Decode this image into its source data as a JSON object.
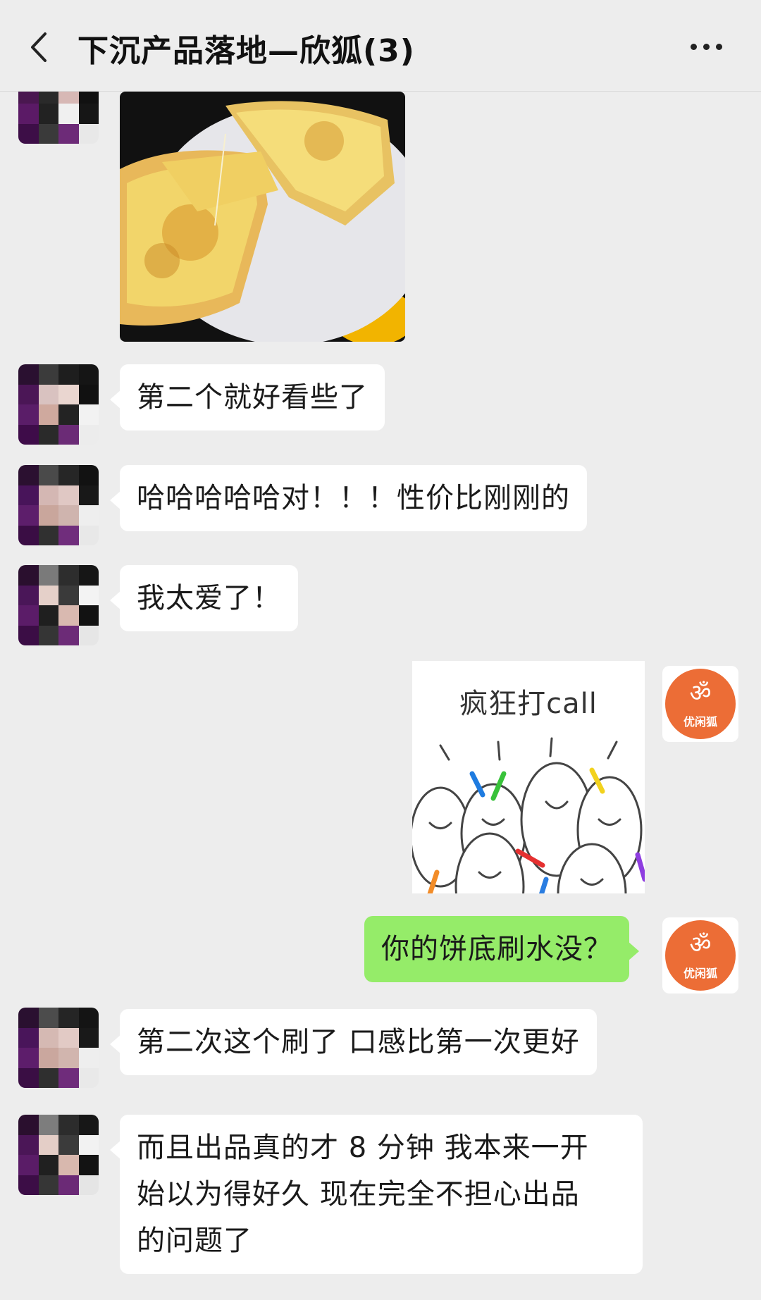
{
  "header": {
    "title": "下沉产品落地—欣狐(3)",
    "back_icon": "chevron-left-icon",
    "more_icon": "more-dots-icon"
  },
  "messages": [
    {
      "side": "left",
      "type": "image",
      "content": "pizza-photo"
    },
    {
      "side": "left",
      "type": "text",
      "text": "第二个就好看些了"
    },
    {
      "side": "left",
      "type": "text",
      "text": "哈哈哈哈哈对！！！性价比刚刚的"
    },
    {
      "side": "left",
      "type": "text",
      "text": "我太爱了！"
    },
    {
      "side": "right",
      "type": "sticker",
      "caption": "疯狂打call"
    },
    {
      "side": "right",
      "type": "text",
      "text": "你的饼底刷水没？"
    },
    {
      "side": "left",
      "type": "text",
      "text": "第二次这个刷了 口感比第一次更好"
    },
    {
      "side": "left",
      "type": "text",
      "lines": [
        "而且出品真的才 8 分钟 我本来一开",
        "始以为得好久 现在完全不担心出品",
        "的问题了"
      ]
    }
  ],
  "self_avatar": {
    "label": "优闲狐",
    "color": "#ec6d36"
  },
  "colors": {
    "background": "#ededed",
    "self_bubble": "#95ec69",
    "other_bubble": "#ffffff"
  }
}
